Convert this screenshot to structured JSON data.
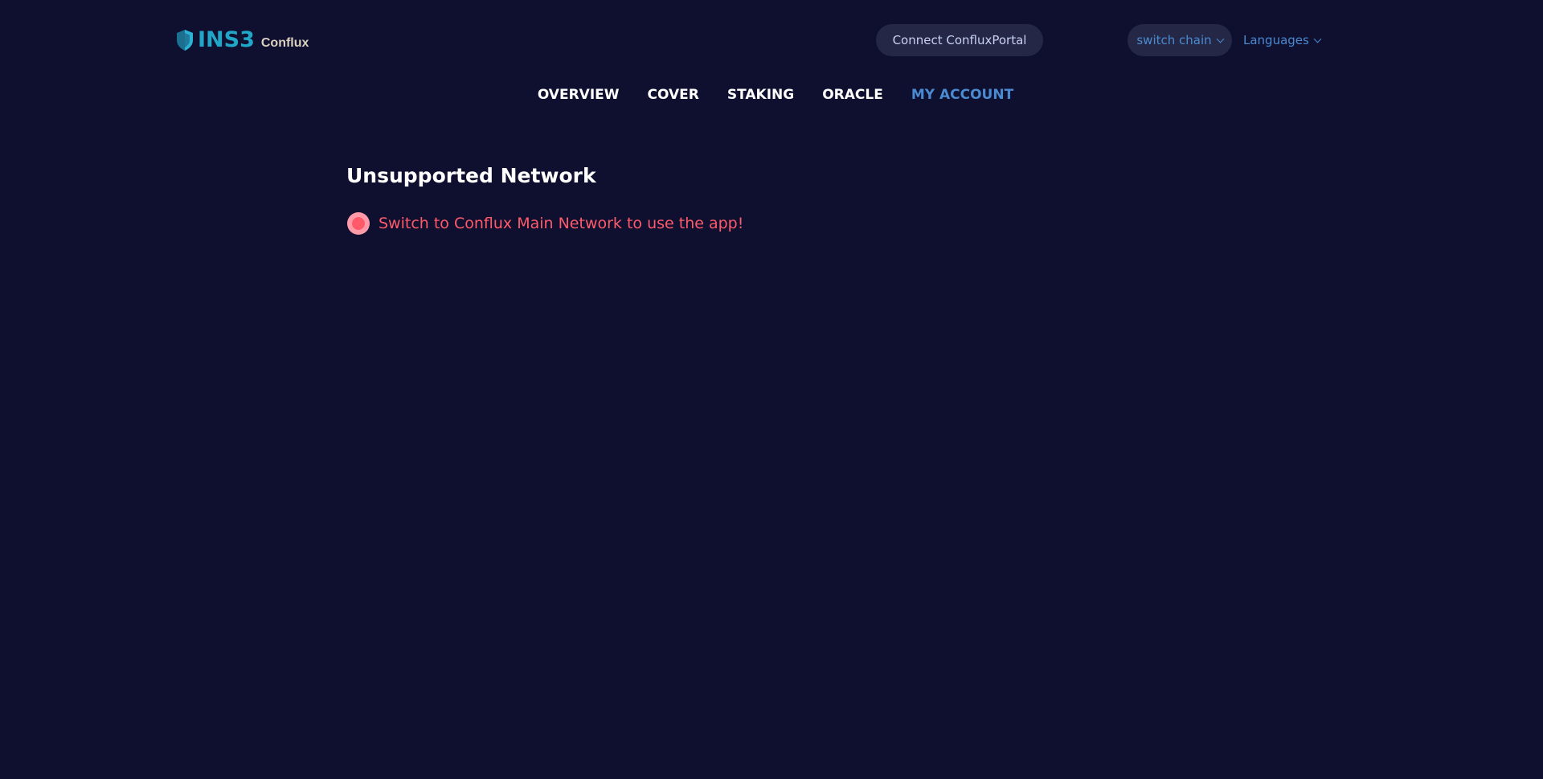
{
  "header": {
    "logo_text": "INS3",
    "logo_subtitle": "Conflux",
    "connect_label": "Connect ConfluxPortal",
    "switch_chain_label": "switch chain",
    "languages_label": "Languages"
  },
  "nav": {
    "items": [
      {
        "label": "OVERVIEW",
        "active": false
      },
      {
        "label": "COVER",
        "active": false
      },
      {
        "label": "STAKING",
        "active": false
      },
      {
        "label": "ORACLE",
        "active": false
      },
      {
        "label": "MY ACCOUNT",
        "active": true
      }
    ]
  },
  "main": {
    "title": "Unsupported Network",
    "alert_message": "Switch to Conflux Main Network to use the app!"
  },
  "colors": {
    "background": "#0f1030",
    "brand": "#22a6c7",
    "accent": "#4a8ad0",
    "error": "#ff5a6a",
    "button_bg": "#242846"
  },
  "icons": {
    "logo": "shield-icon",
    "dropdown": "chevron-down-icon",
    "alert": "error-dot-icon"
  }
}
